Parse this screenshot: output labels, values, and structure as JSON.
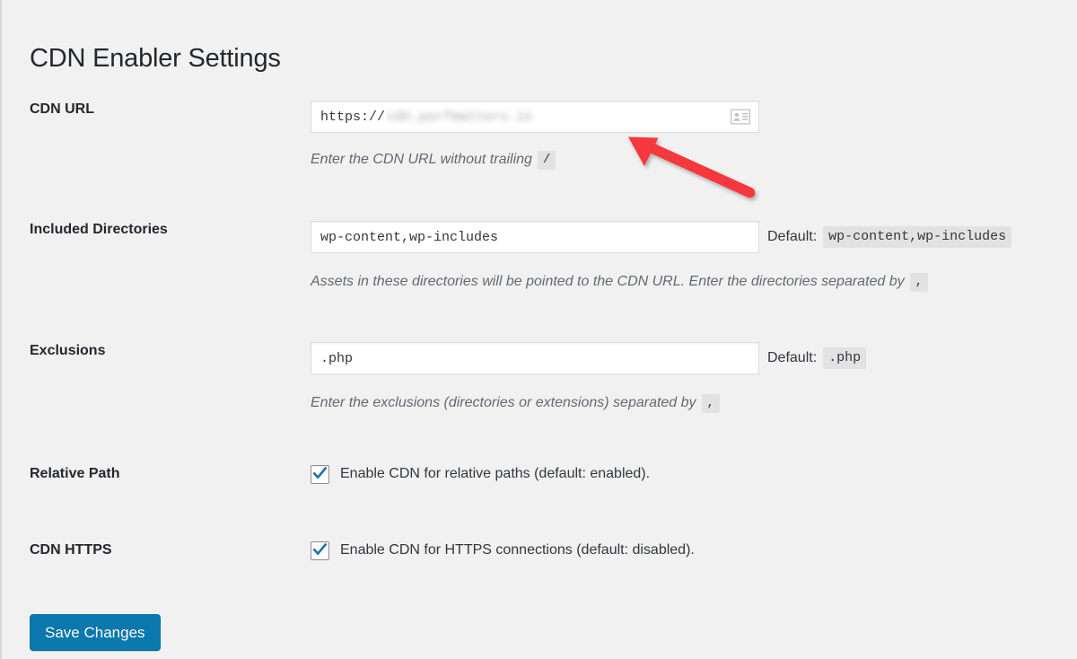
{
  "page": {
    "title": "CDN Enabler Settings",
    "background_color": "#f1f1f1",
    "accent_color": "#0b79ad",
    "annotation_color": "#f4393c"
  },
  "fields": {
    "cdn_url": {
      "label": "CDN URL",
      "value_scheme": "https://",
      "value_redacted": "cdn.perfmatters.io",
      "autofill_icon": "contact-card-icon",
      "help_text": "Enter the CDN URL without trailing",
      "help_code": "/"
    },
    "included_directories": {
      "label": "Included Directories",
      "value": "wp-content,wp-includes",
      "default_label": "Default:",
      "default_value": "wp-content,wp-includes",
      "help_text": "Assets in these directories will be pointed to the CDN URL. Enter the directories separated by",
      "help_code": ","
    },
    "exclusions": {
      "label": "Exclusions",
      "value": ".php",
      "default_label": "Default:",
      "default_value": ".php",
      "help_text": "Enter the exclusions (directories or extensions) separated by",
      "help_code": ","
    },
    "relative_path": {
      "label": "Relative Path",
      "checkbox_label": "Enable CDN for relative paths (default: enabled).",
      "checked": true
    },
    "cdn_https": {
      "label": "CDN HTTPS",
      "checkbox_label": "Enable CDN for HTTPS connections (default: disabled).",
      "checked": true
    }
  },
  "actions": {
    "save_label": "Save Changes"
  }
}
